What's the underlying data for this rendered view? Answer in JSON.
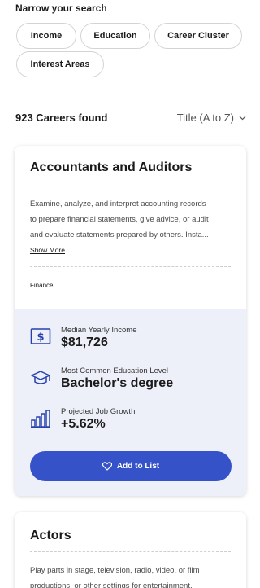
{
  "filters": {
    "heading": "Narrow your search",
    "chips": [
      "Income",
      "Education",
      "Career Cluster",
      "Interest Areas"
    ]
  },
  "results": {
    "count_label": "923 Careers found",
    "sort_label": "Title (A to Z)"
  },
  "cards": [
    {
      "title": "Accountants and Auditors",
      "description_lines": [
        "Examine, analyze, and interpret accounting records",
        "to prepare financial statements, give advice, or audit",
        "and evaluate statements prepared by others. Insta..."
      ],
      "show_more": "Show More",
      "tag": "Finance",
      "stats": {
        "income_label": "Median Yearly Income",
        "income_value": "$81,726",
        "education_label": "Most Common Education Level",
        "education_value": "Bachelor's degree",
        "growth_label": "Projected Job Growth",
        "growth_value": "+5.62%"
      },
      "add_button": "Add to List"
    },
    {
      "title": "Actors",
      "description_lines": [
        "Play parts in stage, television, radio, video, or film",
        "productions, or other settings for entertainment,"
      ]
    }
  ],
  "colors": {
    "accent": "#3552c8",
    "stats_background": "#eef0f9"
  },
  "icons": [
    "dollar-icon",
    "graduation-cap-icon",
    "growth-chart-icon",
    "heart-icon",
    "chevron-down-icon"
  ]
}
